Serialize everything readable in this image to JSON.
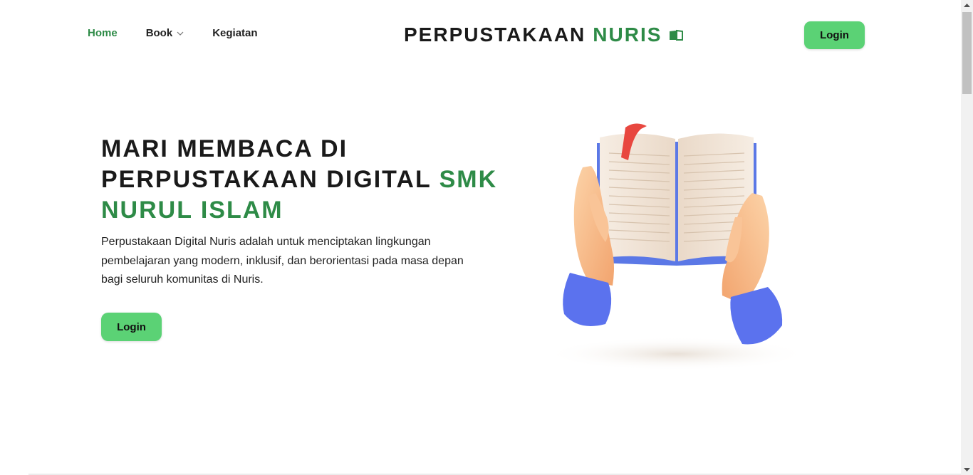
{
  "nav": {
    "home": "Home",
    "book": "Book",
    "kegiatan": "Kegiatan"
  },
  "brand": {
    "part1": "PERPUSTAKAAN",
    "part2": "NURIS"
  },
  "header_login": "Login",
  "hero": {
    "title_line1": "MARI MEMBACA DI",
    "title_line2_a": "PERPUSTAKAAN DIGITAL ",
    "title_line2_b": "SMK",
    "title_line3": "NURUL ISLAM",
    "description": "Perpustakaan Digital Nuris adalah untuk menciptakan lingkungan pembelajaran yang modern, inklusif, dan berorientasi pada masa depan bagi seluruh komunitas di Nuris.",
    "login": "Login"
  },
  "icons": {
    "brand": "book-open-icon",
    "dropdown": "chevron-down-icon"
  },
  "colors": {
    "accent": "#2e8b47",
    "button": "#5bd275"
  }
}
